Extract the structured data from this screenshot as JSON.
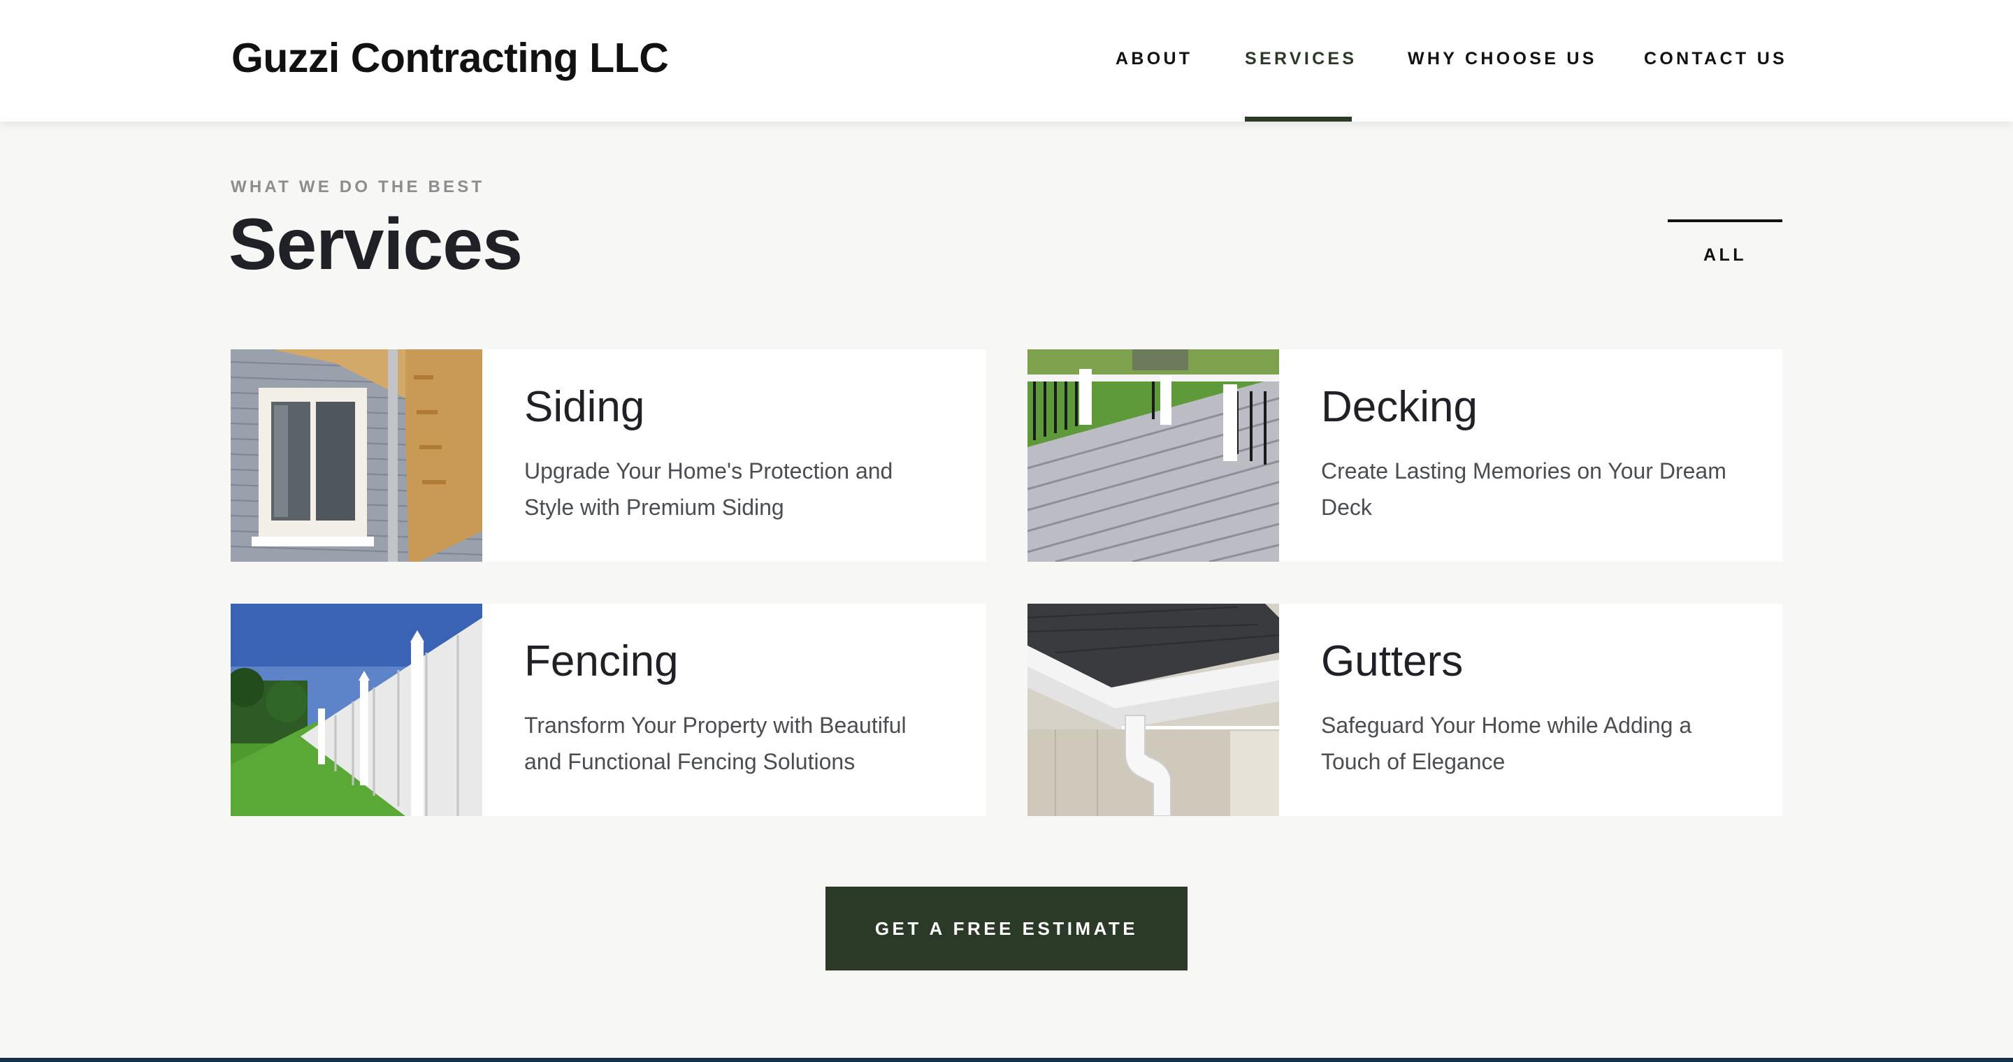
{
  "header": {
    "brand": "Guzzi Contracting LLC",
    "nav": [
      {
        "label": "ABOUT"
      },
      {
        "label": "SERVICES",
        "active": true
      },
      {
        "label": "WHY CHOOSE US"
      },
      {
        "label": "CONTACT US"
      }
    ]
  },
  "section": {
    "eyebrow": "WHAT WE DO THE BEST",
    "title": "Services",
    "filter_label": "ALL"
  },
  "services": [
    {
      "title": "Siding",
      "description": "Upgrade Your Home's Protection and Style with Premium Siding",
      "image_icon": "siding-photo"
    },
    {
      "title": "Decking",
      "description": "Create Lasting Memories on Your Dream Deck",
      "image_icon": "decking-photo"
    },
    {
      "title": "Fencing",
      "description": "Transform Your Property with Beautiful and Functional Fencing Solutions",
      "image_icon": "fencing-photo"
    },
    {
      "title": "Gutters",
      "description": "Safeguard Your Home while Adding a Touch of Elegance",
      "image_icon": "gutters-photo"
    }
  ],
  "cta": {
    "label": "GET A FREE ESTIMATE"
  },
  "colors": {
    "accent": "#2a3a26",
    "background": "#f7f7f6",
    "card": "#ffffff",
    "text": "#1f2126",
    "muted": "#8d8d8d"
  }
}
